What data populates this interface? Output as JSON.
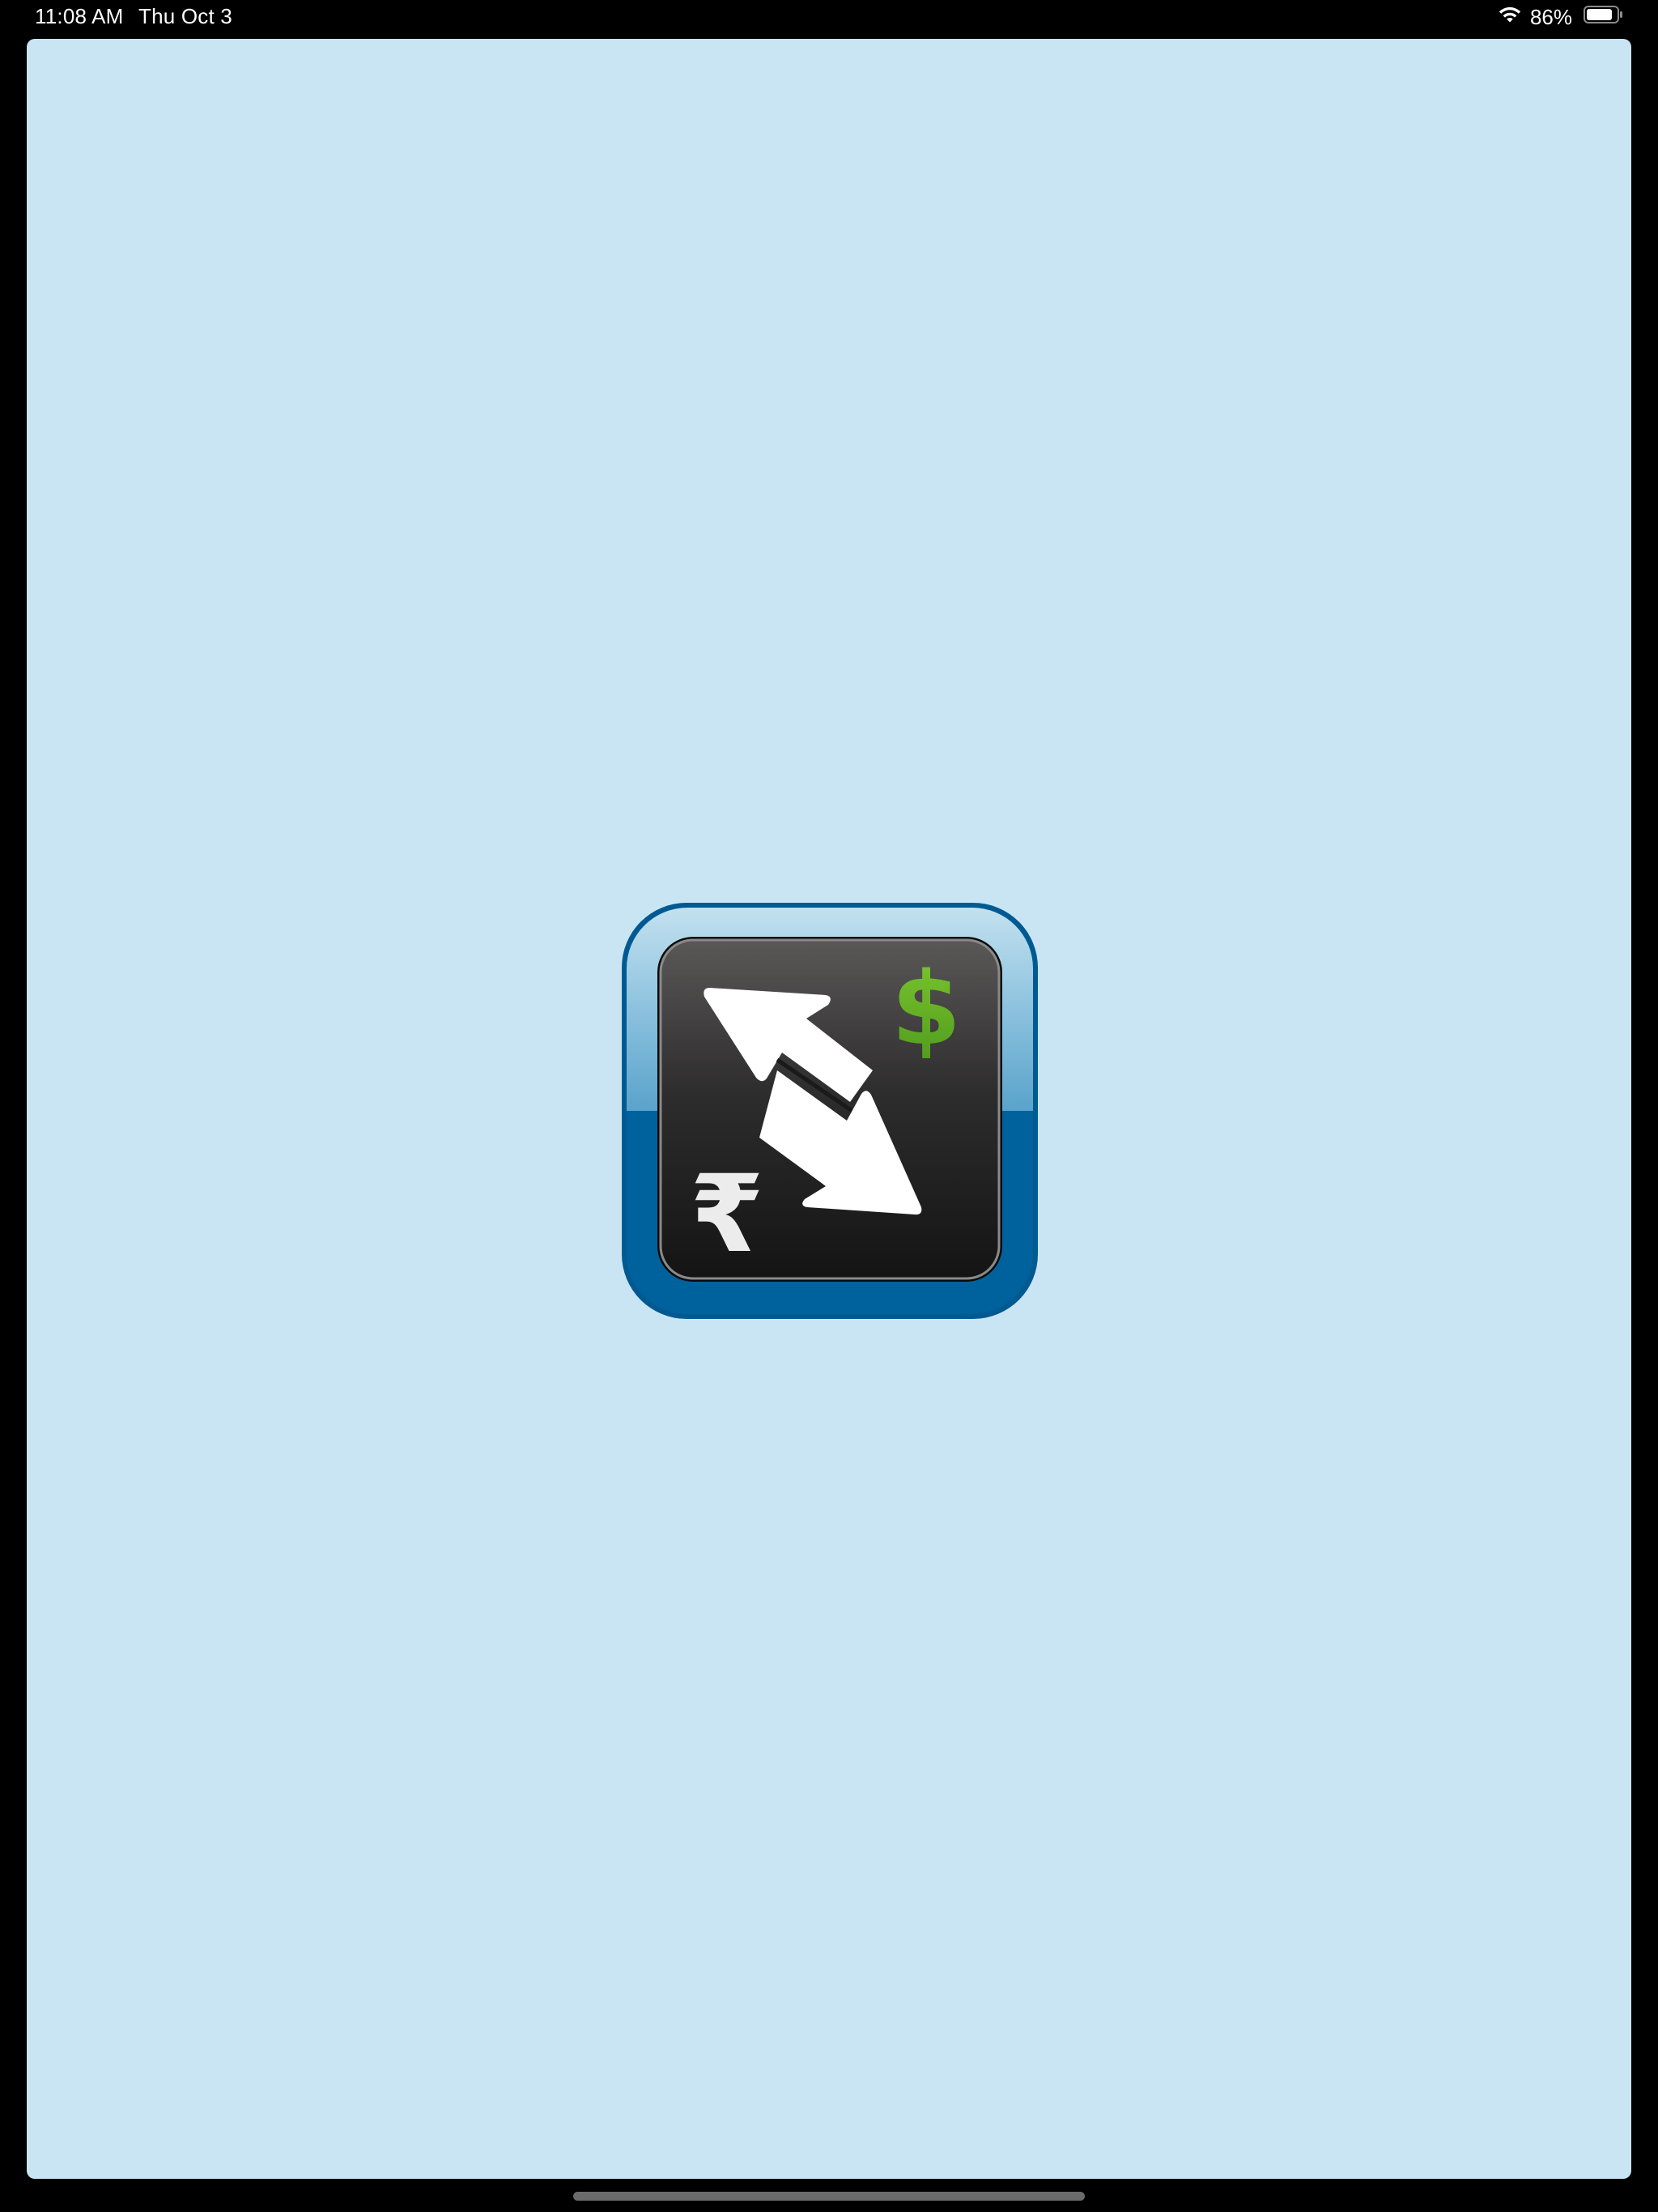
{
  "status_bar": {
    "time": "11:08 AM",
    "date": "Thu Oct 3",
    "battery_percent": "86%",
    "battery_level": 0.86,
    "icons": [
      "wifi-icon",
      "battery-icon"
    ]
  },
  "splash": {
    "logo_icon": "currency-exchange-logo-icon",
    "logo_glyphs": [
      "$",
      "₹"
    ],
    "colors": {
      "background": "#c9e5f3",
      "logo_frame": "#00629c",
      "logo_frame_light": "#a6d0e6",
      "logo_tile": "#2b2a2a",
      "dollar": "#6fb82c",
      "rupee": "#ececec",
      "arrows": "#ffffff"
    }
  }
}
